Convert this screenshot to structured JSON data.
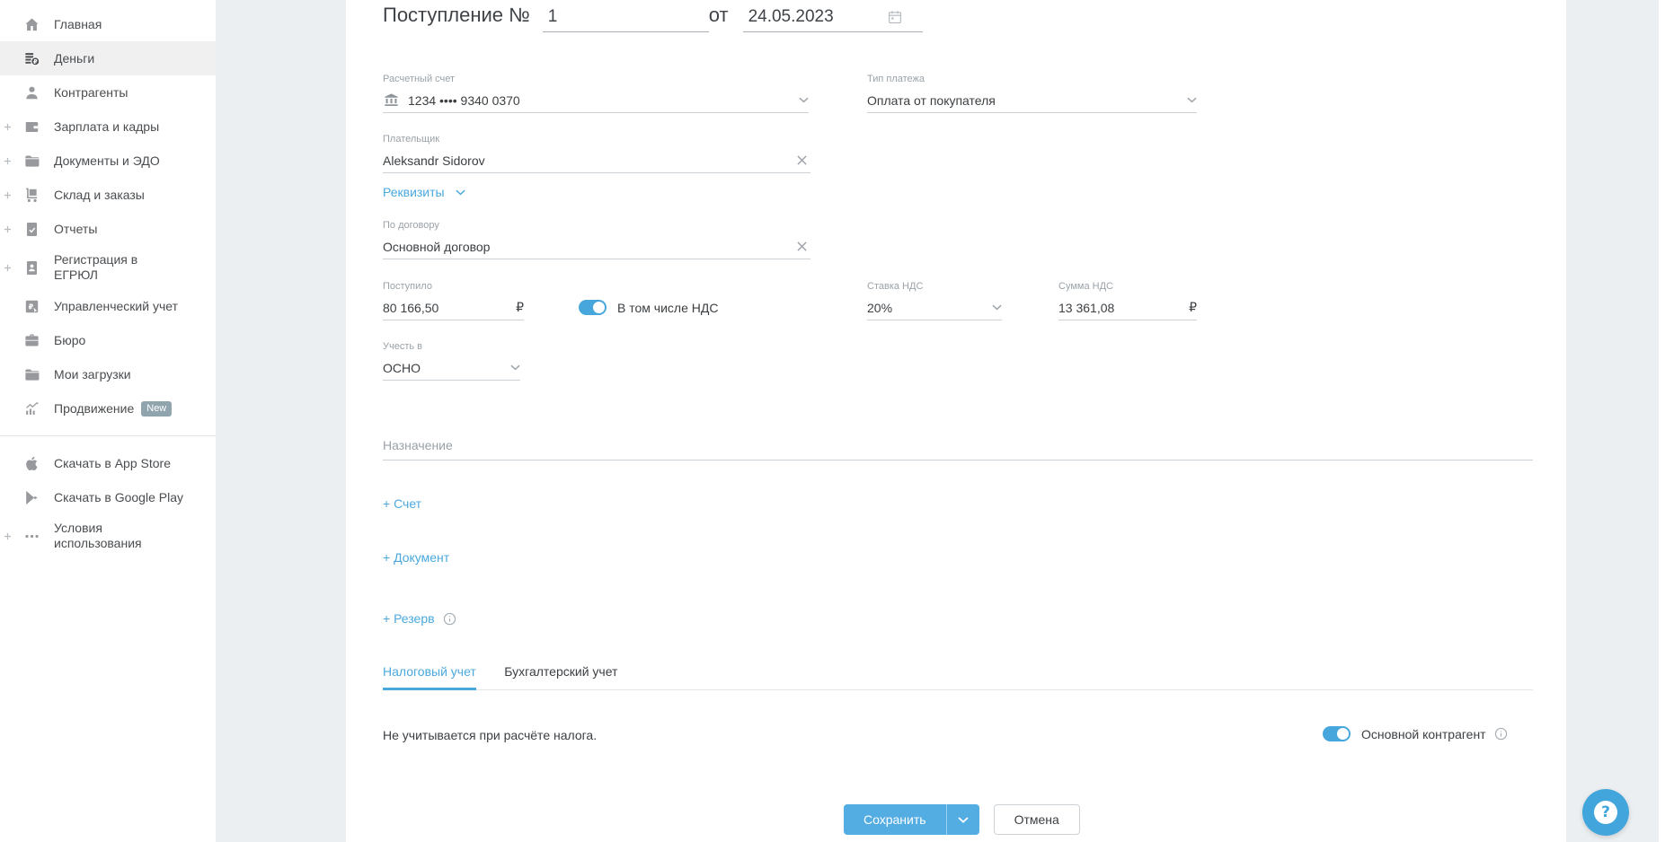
{
  "sidebar": {
    "items": [
      {
        "label": "Главная",
        "icon": "home-icon",
        "expandable": false,
        "active": false
      },
      {
        "label": "Деньги",
        "icon": "money-icon",
        "expandable": false,
        "active": true
      },
      {
        "label": "Контрагенты",
        "icon": "contractors-icon",
        "expandable": false,
        "active": false
      },
      {
        "label": "Зарплата и кадры",
        "icon": "salary-icon",
        "expandable": true,
        "active": false
      },
      {
        "label": "Документы и ЭДО",
        "icon": "documents-folder-icon",
        "expandable": true,
        "active": false
      },
      {
        "label": "Склад и заказы",
        "icon": "warehouse-trolley-icon",
        "expandable": true,
        "active": false
      },
      {
        "label": "Отчеты",
        "icon": "reports-icon",
        "expandable": true,
        "active": false
      },
      {
        "label": "Регистрация в ЕГРЮЛ",
        "icon": "registration-icon",
        "expandable": true,
        "active": false
      },
      {
        "label": "Управленческий учет",
        "icon": "management-ruble-icon",
        "expandable": false,
        "active": false
      },
      {
        "label": "Бюро",
        "icon": "briefcase-icon",
        "expandable": false,
        "active": false
      },
      {
        "label": "Мои загрузки",
        "icon": "downloads-folder-icon",
        "expandable": false,
        "active": false
      },
      {
        "label": "Продвижение",
        "icon": "promotion-chart-icon",
        "expandable": false,
        "active": false,
        "badge": "New"
      }
    ],
    "footer_items": [
      {
        "label": "Скачать в App Store",
        "icon": "apple-icon"
      },
      {
        "label": "Скачать в Google Play",
        "icon": "google-play-icon"
      },
      {
        "label": "Условия использования",
        "icon": "ellipsis-icon",
        "expandable": true
      }
    ]
  },
  "form": {
    "title": "Поступление №",
    "number": "1",
    "date_label": "от",
    "date": "24.05.2023",
    "currency": "₽",
    "account": {
      "label": "Расчетный счет",
      "value": "1234 •••• 9340 0370"
    },
    "payment_type": {
      "label": "Тип платежа",
      "value": "Оплата от покупателя"
    },
    "payer": {
      "label": "Плательщик",
      "value": "Aleksandr Sidorov"
    },
    "details_link": "Реквизиты",
    "contract": {
      "label": "По договору",
      "value": "Основной договор"
    },
    "received": {
      "label": "Поступило",
      "value": "80 166,50"
    },
    "vat_toggle": {
      "label": "В том числе НДС",
      "on": true
    },
    "vat_rate": {
      "label": "Ставка НДС",
      "value": "20%"
    },
    "vat_amount": {
      "label": "Сумма НДС",
      "value": "13 361,08"
    },
    "account_in": {
      "label": "Учесть в",
      "value": "ОСНО"
    },
    "purpose_placeholder": "Назначение",
    "links": {
      "invoice": "+ Счет",
      "document": "+ Документ",
      "reserve": "+ Резерв"
    },
    "tabs": [
      {
        "label": "Налоговый учет",
        "active": true
      },
      {
        "label": "Бухгалтерский учет",
        "active": false
      }
    ],
    "tax_note": "Не учитывается при расчёте налога.",
    "contractor_toggle": {
      "label": "Основной контрагент",
      "on": true
    },
    "buttons": {
      "save": "Сохранить",
      "cancel": "Отмена"
    }
  },
  "help": {
    "glyph": "?"
  },
  "colors": {
    "accent": "#4aa8dd",
    "save_button": "#54ade2",
    "page_background": "#eceff1",
    "active_item_background": "#f0f0f0",
    "badge_background": "#90a4ae"
  }
}
